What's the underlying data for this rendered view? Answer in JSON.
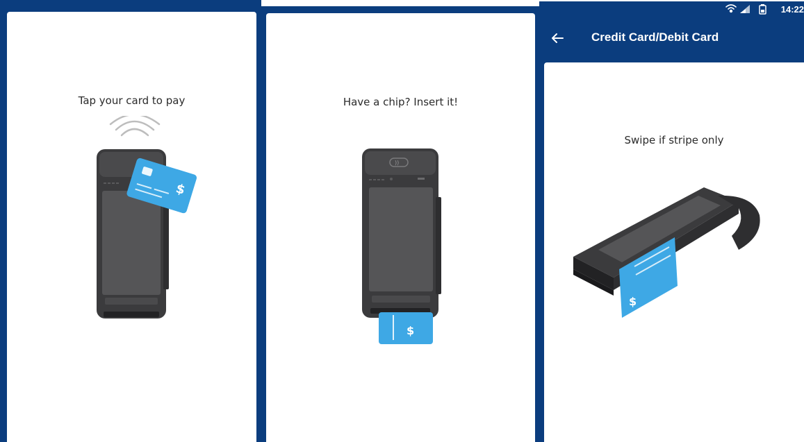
{
  "panels": [
    {
      "prompt": "Tap your card to pay",
      "illustration": "tap-card-terminal-illustration"
    },
    {
      "prompt": "Have a chip?  Insert it!",
      "illustration": "insert-chip-terminal-illustration"
    },
    {
      "prompt": "Swipe if stripe only",
      "illustration": "swipe-card-terminal-illustration"
    }
  ],
  "status_bar": {
    "time": "14:22",
    "icons": [
      "wifi-icon",
      "signal-icon",
      "battery-icon"
    ]
  },
  "app_bar": {
    "title": "Credit Card/Debit Card",
    "back_icon": "arrow-left-icon"
  },
  "colors": {
    "brand_navy": "#0b3d7e",
    "card_blue": "#3ea8e5",
    "terminal_dark": "#3b3b3d",
    "screen_gray": "#555557",
    "text": "#2b2b2b"
  }
}
